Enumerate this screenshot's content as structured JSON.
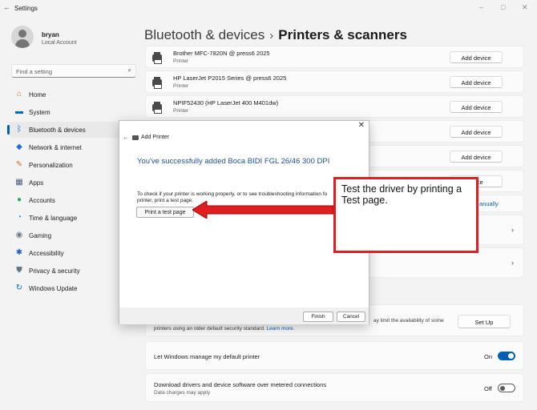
{
  "window": {
    "title": "Settings",
    "back": "←",
    "controls": {
      "minimize": "–",
      "maximize": "□",
      "close": "✕"
    }
  },
  "user": {
    "name": "bryan",
    "account_type": "Local Account"
  },
  "search": {
    "placeholder": "Find a setting",
    "icon": "search-icon"
  },
  "sidebar": {
    "items": [
      {
        "label": "Home",
        "icon": "home-icon",
        "glyph": "⌂",
        "color": "#c0782a"
      },
      {
        "label": "System",
        "icon": "system-icon",
        "glyph": "▬",
        "color": "#0067c0"
      },
      {
        "label": "Bluetooth & devices",
        "icon": "bluetooth-icon",
        "glyph": "ᛒ",
        "color": "#0078d4"
      },
      {
        "label": "Network & internet",
        "icon": "network-icon",
        "glyph": "◆",
        "color": "#1f6fd0"
      },
      {
        "label": "Personalization",
        "icon": "personalization-icon",
        "glyph": "✎",
        "color": "#c4702a"
      },
      {
        "label": "Apps",
        "icon": "apps-icon",
        "glyph": "▦",
        "color": "#4a5a78"
      },
      {
        "label": "Accounts",
        "icon": "accounts-icon",
        "glyph": "●",
        "color": "#2fa36a"
      },
      {
        "label": "Time & language",
        "icon": "time-language-icon",
        "glyph": "◔",
        "color": "#1d8bd8"
      },
      {
        "label": "Gaming",
        "icon": "gaming-icon",
        "glyph": "◉",
        "color": "#6b7b8c"
      },
      {
        "label": "Accessibility",
        "icon": "accessibility-icon",
        "glyph": "✱",
        "color": "#1f5fb8"
      },
      {
        "label": "Privacy & security",
        "icon": "privacy-shield-icon",
        "glyph": "⛊",
        "color": "#6b7480"
      },
      {
        "label": "Windows Update",
        "icon": "windows-update-icon",
        "glyph": "↻",
        "color": "#0067c0"
      }
    ],
    "active_index": 2
  },
  "breadcrumb": {
    "parent": "Bluetooth & devices",
    "separator": "›",
    "current": "Printers & scanners"
  },
  "printers": [
    {
      "name": "Brother MFC-7820N @ press6 2025",
      "type": "Printer",
      "button": "Add device"
    },
    {
      "name": "HP LaserJet P2015 Series @ press6 2025",
      "type": "Printer",
      "button": "Add device"
    },
    {
      "name": "NPIF52430 (HP LaserJet 400 M401dw)",
      "type": "Printer",
      "button": "Add device"
    }
  ],
  "hidden_rows": {
    "add_device_1": "Add device",
    "add_device_2": "Add device",
    "add_device_3_partial": "evice",
    "manually_partial": "anually"
  },
  "security_row": {
    "visible_right_text": "ay limit the availability of some",
    "line2_text": "printers using an older default security standard.",
    "learn_more": "Learn more.",
    "button": "Set Up"
  },
  "settings": [
    {
      "label": "Let Windows manage my default printer",
      "sub": "",
      "state": "On",
      "on": true
    },
    {
      "label": "Download drivers and device software over metered connections",
      "sub": "Data charges may apply",
      "state": "Off",
      "on": false
    }
  ],
  "dialog": {
    "title": "Add Printer",
    "close": "✕",
    "back": "←",
    "heading": "You've successfully added Boca BIDI FGL 26/46 300 DPI",
    "body_line1": "To check if your printer is working properly, or to see troubleshooting information fo",
    "body_line2": "printer, print a test page.",
    "test_button": "Print a test page",
    "finish": "Finish",
    "cancel": "Cancel"
  },
  "annotation": {
    "text": "Test the driver by printing a Test page.",
    "color": "#e02020"
  },
  "colors": {
    "accent": "#005fb8",
    "dialog_heading": "#1f4e9c"
  }
}
